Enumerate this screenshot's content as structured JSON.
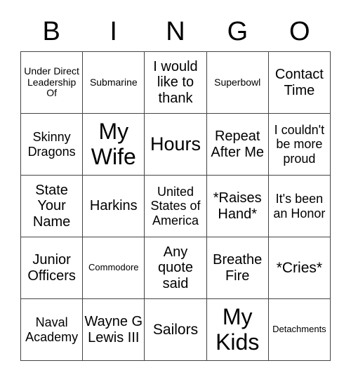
{
  "header": [
    "B",
    "I",
    "N",
    "G",
    "O"
  ],
  "cells": [
    "Under Direct Leadership Of",
    "Submarine",
    "I would like to thank",
    "Superbowl",
    "Contact Time",
    "Skinny Dragons",
    "My Wife",
    "Hours",
    "Repeat After Me",
    "I couldn't be more proud",
    "State Your Name",
    "Harkins",
    "United States of America",
    "*Raises Hand*",
    "It's been an Honor",
    "Junior Officers",
    "Commodore",
    "Any quote said",
    "Breathe Fire",
    "*Cries*",
    "Naval Academy",
    "Wayne G Lewis III",
    "Sailors",
    "My Kids",
    "Detachments"
  ]
}
